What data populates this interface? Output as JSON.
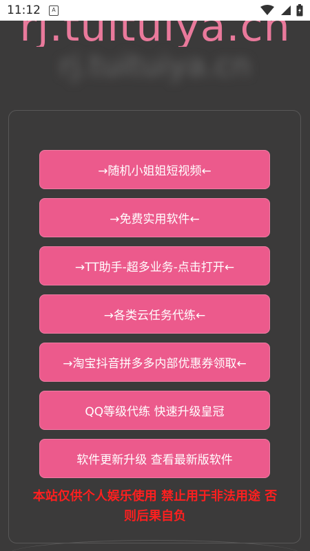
{
  "status_bar": {
    "time": "11:12",
    "notification_glyph": "A",
    "icons": [
      "wifi-icon",
      "signal-icon",
      "battery-icon"
    ]
  },
  "banner": {
    "domain_text": "rj.tuituiya.cn",
    "blurred_text": "rj.tuituiya.cn"
  },
  "menu": {
    "items": [
      {
        "label": "→随机小姐姐短视频←"
      },
      {
        "label": "→免费实用软件←"
      },
      {
        "label": "→TT助手-超多业务-点击打开←"
      },
      {
        "label": "→各类云任务代练←"
      },
      {
        "label": "→淘宝抖音拼多多内部优惠券领取←"
      },
      {
        "label": "QQ等级代练 快速升级皇冠"
      },
      {
        "label": "软件更新升级 查看最新版软件"
      }
    ]
  },
  "disclaimer": "本站仅供个人娱乐使用 禁止用于非法用途 否则后果自负",
  "colors": {
    "background": "#3b3a3a",
    "button": "#ec5a8c",
    "banner": "#e9799b",
    "disclaimer": "#ff1f1f"
  }
}
